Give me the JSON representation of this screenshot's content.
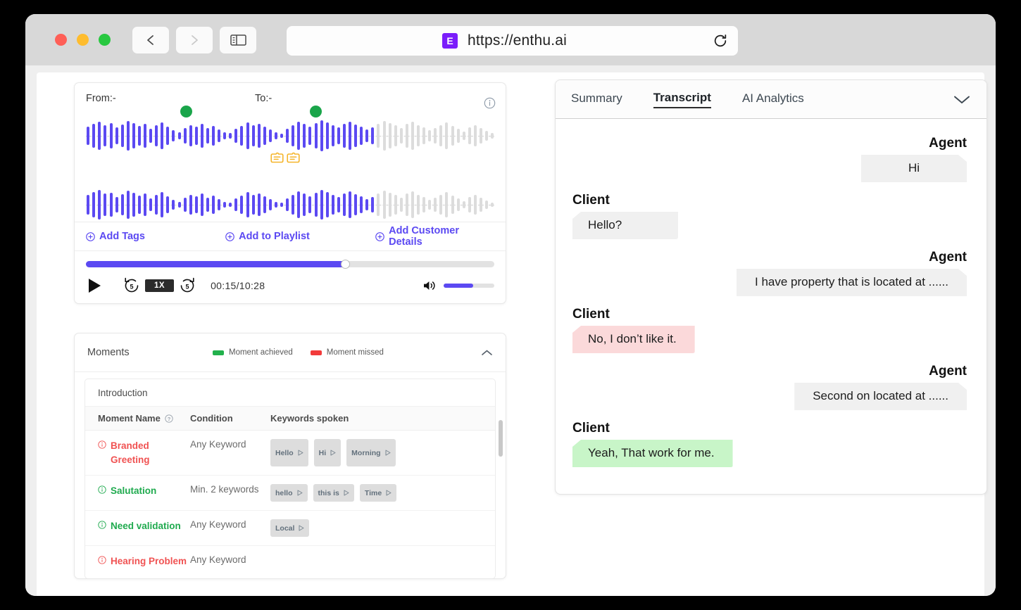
{
  "browser": {
    "traffic_lights": [
      "close",
      "minimize",
      "zoom"
    ],
    "back_label": "Back",
    "forward_label": "Forward",
    "sidebar_label": "Sidebar",
    "favicon_letter": "E",
    "url": "https://enthu.ai",
    "reload_label": "Reload"
  },
  "player": {
    "from_label": "From:-",
    "to_label": "To:-",
    "info_tooltip": "Info",
    "actions": [
      {
        "label": "Add Tags",
        "name": "add-tags"
      },
      {
        "label": "Add to Playlist",
        "name": "add-to-playlist"
      },
      {
        "label": "Add Customer Details",
        "name": "add-customer-details"
      }
    ],
    "progress_percent": 63.5,
    "play_label": "Play",
    "rewind_label": "5",
    "speed": "1X",
    "forward_label": "5",
    "time": "00:15/10:28",
    "volume_percent": 58,
    "accent_color": "#5b49f2",
    "marker_color": "#1aa54a",
    "note_color": "#f5b52a"
  },
  "moments": {
    "title": "Moments",
    "legend": [
      {
        "label": "Moment achieved",
        "color": "#22b14c"
      },
      {
        "label": "Moment missed",
        "color": "#f23b3b"
      }
    ],
    "collapse_label": "Collapse",
    "section": "Introduction",
    "columns": [
      "Moment Name",
      "Condition",
      "Keywords spoken"
    ],
    "rows": [
      {
        "name": "Branded Greeting",
        "status": "missed",
        "condition": "Any Keyword",
        "keywords": [
          "Hello",
          "Hi",
          "Morning"
        ]
      },
      {
        "name": "Salutation",
        "status": "achieved",
        "condition": "Min. 2 keywords",
        "keywords": [
          "hello",
          "this is",
          "Time"
        ]
      },
      {
        "name": "Need validation",
        "status": "achieved",
        "condition": "Any Keyword",
        "keywords": [
          "Local"
        ]
      },
      {
        "name": "Hearing Problem",
        "status": "missed",
        "condition": "Any Keyword",
        "keywords": []
      }
    ]
  },
  "transcript": {
    "tabs": [
      {
        "label": "Summary",
        "active": false
      },
      {
        "label": "Transcript",
        "active": true
      },
      {
        "label": "AI Analytics",
        "active": false
      }
    ],
    "expand_label": "Expand",
    "messages": [
      {
        "speaker": "Agent",
        "side": "agent",
        "text": "Hi",
        "tone": "neutral"
      },
      {
        "speaker": "Client",
        "side": "client",
        "text": "Hello?",
        "tone": "neutral"
      },
      {
        "speaker": "Agent",
        "side": "agent",
        "text": "I have property that is located at ......",
        "tone": "neutral"
      },
      {
        "speaker": "Client",
        "side": "client",
        "text": "No, I don’t like it.",
        "tone": "neg"
      },
      {
        "speaker": "Agent",
        "side": "agent",
        "text": "Second on located at ......",
        "tone": "neutral"
      },
      {
        "speaker": "Client",
        "side": "client",
        "text": "Yeah, That work for me.",
        "tone": "pos"
      }
    ]
  }
}
